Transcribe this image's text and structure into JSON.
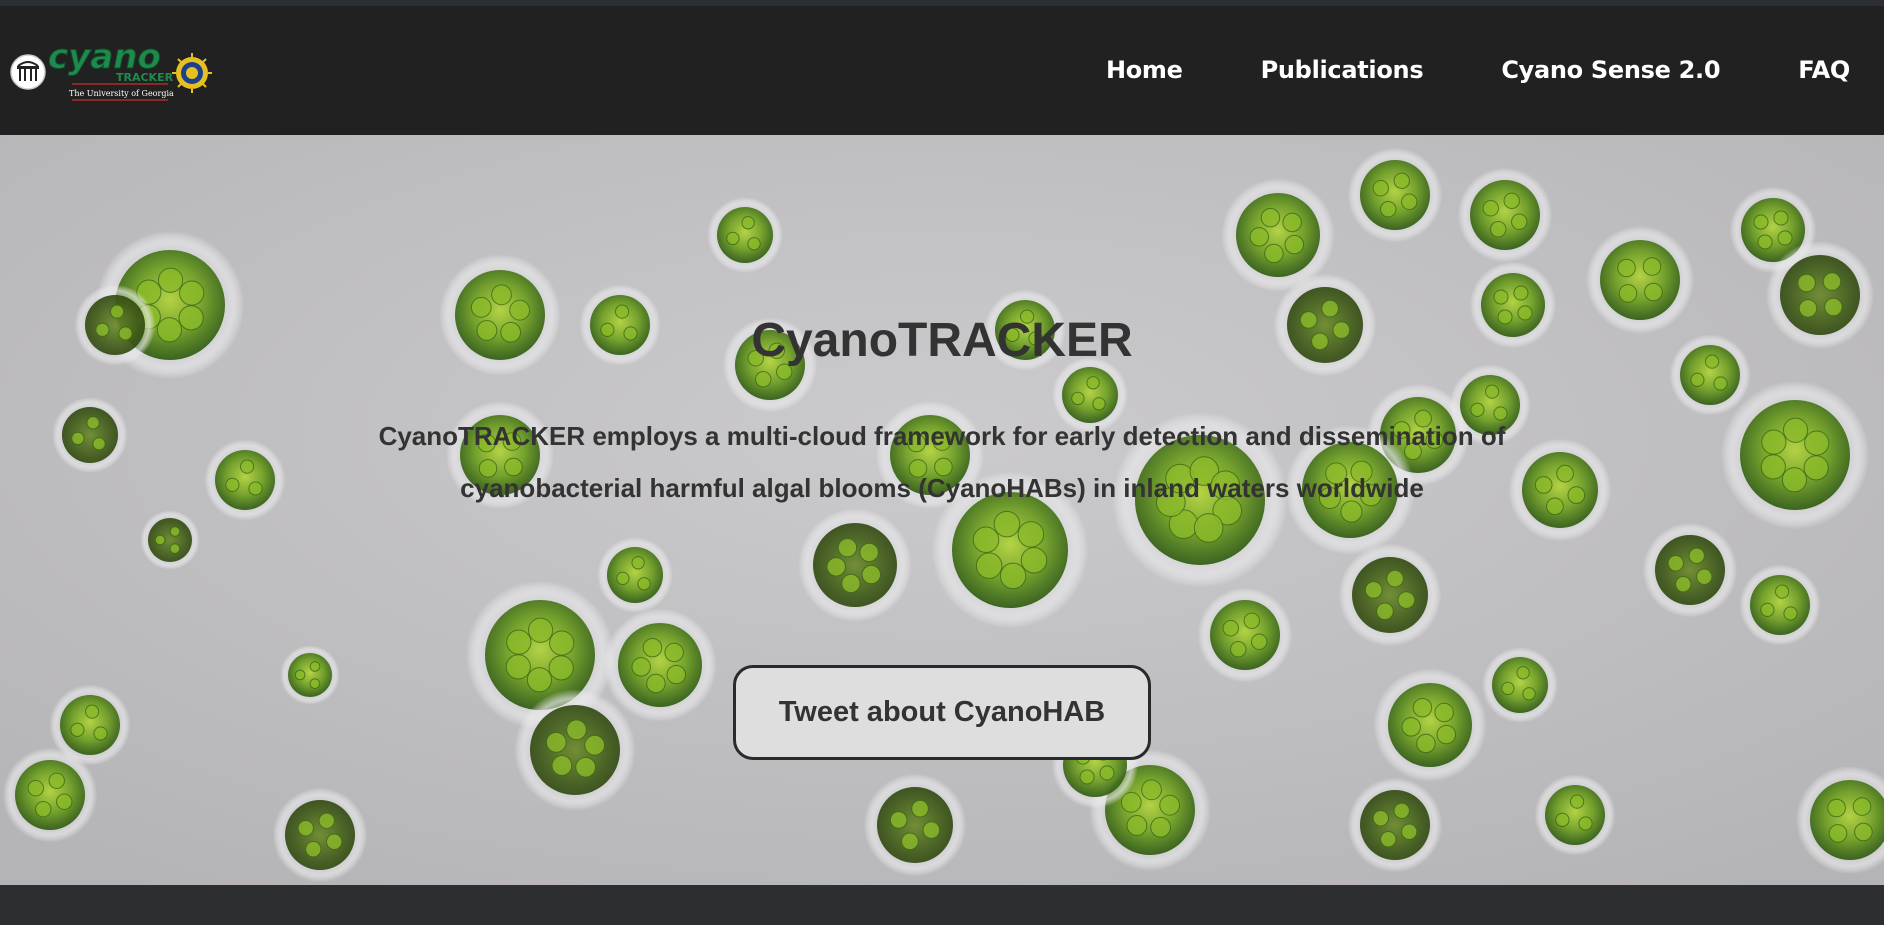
{
  "header": {
    "logo": {
      "wordmark": "cyano",
      "subword": "TRACKER",
      "university": "The University of Georgia",
      "colors": {
        "green": "#1f8a4c",
        "gold": "#e6c020"
      }
    },
    "nav": [
      {
        "label": "Home"
      },
      {
        "label": "Publications"
      },
      {
        "label": "Cyano Sense 2.0"
      },
      {
        "label": "FAQ"
      }
    ]
  },
  "hero": {
    "title": "CyanoTRACKER",
    "description": "CyanoTRACKER employs a multi-cloud framework for early detection and dissemination of cyanobacterial harmful algal blooms (CyanoHABs) in inland waters worldwide",
    "button_label": "Tweet about CyanoHAB",
    "background": "microscope image of green algae cells"
  },
  "colors": {
    "navbar": "#212121",
    "hero_bg": "#c3c2c4",
    "text": "#333333",
    "button_bg": "#dedede",
    "cell_green": "#5f9a1c"
  }
}
